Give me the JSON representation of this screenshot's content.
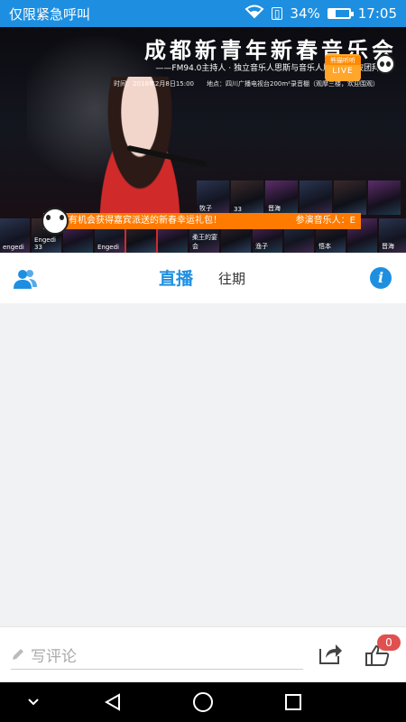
{
  "status_bar": {
    "left_text": "仅限紧急呼叫",
    "battery_percent": "34%",
    "time": "17:05",
    "battery_level": 0.34,
    "icons": [
      "wifi-icon",
      "sim-card-icon",
      "battery-icon"
    ]
  },
  "banner": {
    "title": "成都新青年新春音乐会",
    "subtitle": "——FM94.0主持人 · 独立音乐人思斯与音乐人朋友们电波团拜文",
    "meta": "时间：2018年2月8日15:00　　地点：四川广播电视台200m²录音棚（观摩三楼，欢迎围观）",
    "live_badge": {
      "top": "熊猫听听",
      "label": "LIVE"
    },
    "ticker": {
      "message": "！还有机会获得嘉宾派送的新春幸运礼包！",
      "right_text": "参演音乐人：E"
    },
    "top_thumbs": [
      "牧子",
      "33",
      "晋海",
      "",
      "",
      ""
    ],
    "bottom_thumbs": [
      "engedi",
      "Engedi 33",
      "",
      "Engedi",
      "",
      "",
      "柔王的宴会",
      "",
      "渔子",
      "",
      "悟本",
      "",
      "晋海"
    ]
  },
  "tabs": {
    "live": "直播",
    "past": "往期"
  },
  "comment_bar": {
    "placeholder": "写评论",
    "like_count": "0"
  },
  "colors": {
    "accent": "#1e8fe0",
    "ticker": "#ff7a00",
    "badge": "#e05050"
  }
}
